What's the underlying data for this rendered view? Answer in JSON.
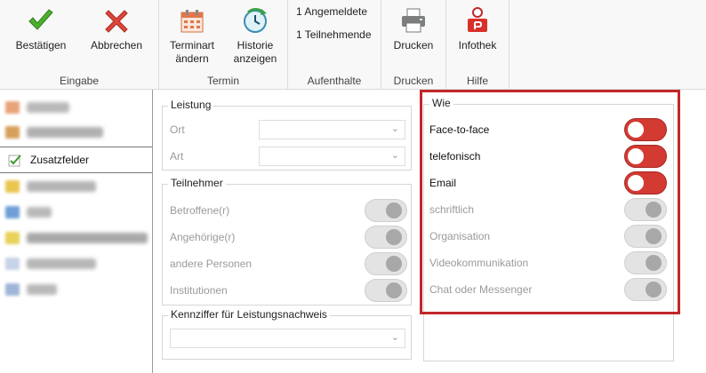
{
  "ribbon": {
    "eingabe": {
      "label": "Eingabe",
      "confirm": "Bestätigen",
      "cancel": "Abbrechen"
    },
    "termin": {
      "label": "Termin",
      "change_type_line1": "Terminart",
      "change_type_line2": "ändern",
      "history_line1": "Historie",
      "history_line2": "anzeigen"
    },
    "aufenthalte": {
      "label": "Aufenthalte",
      "registered": "1 Angemeldete",
      "participants": "1 Teilnehmende"
    },
    "drucken": {
      "label": "Drucken",
      "print": "Drucken"
    },
    "hilfe": {
      "label": "Hilfe",
      "infothek": "Infothek"
    }
  },
  "nav": {
    "active_item": "Zusatzfelder"
  },
  "leistung": {
    "legend": "Leistung",
    "ort_label": "Ort",
    "art_label": "Art"
  },
  "teilnehmer": {
    "legend": "Teilnehmer",
    "items": [
      {
        "label": "Betroffene(r)",
        "on": false
      },
      {
        "label": "Angehörige(r)",
        "on": false
      },
      {
        "label": "andere Personen",
        "on": false
      },
      {
        "label": "Institutionen",
        "on": false
      }
    ]
  },
  "kennziffer": {
    "legend": "Kennziffer für Leistungsnachweis"
  },
  "wie": {
    "legend": "Wie",
    "items": [
      {
        "label": "Face-to-face",
        "on": true
      },
      {
        "label": "telefonisch",
        "on": true
      },
      {
        "label": "Email",
        "on": true
      },
      {
        "label": "schriftlich",
        "on": false
      },
      {
        "label": "Organisation",
        "on": false
      },
      {
        "label": "Videokommunikation",
        "on": false
      },
      {
        "label": "Chat oder Messenger",
        "on": false
      }
    ]
  },
  "colors": {
    "toggle_on": "#d33a32",
    "highlight": "#c0282a"
  }
}
